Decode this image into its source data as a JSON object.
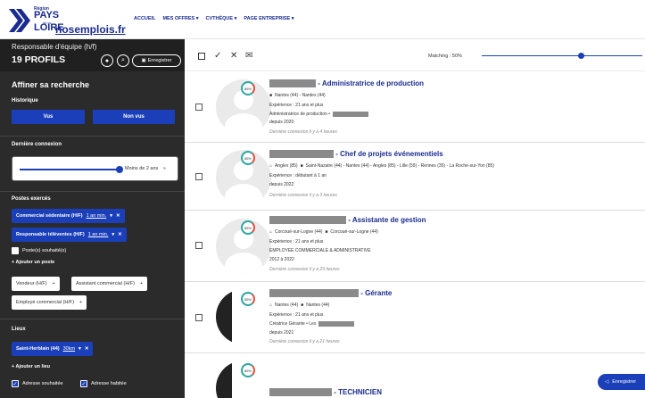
{
  "header": {
    "logo": {
      "region": "Région",
      "pays": "PAYS",
      "dela": "de la",
      "loire": "LOIRE",
      "brand": "nosemplois.fr"
    },
    "nav": [
      "ACCUEIL",
      "MES OFFRES ▾",
      "CVTHÈQUE ▾",
      "PAGE ENTREPRISE ▾"
    ]
  },
  "sidebar": {
    "job_title": "Responsable d'équipe (h/f)",
    "profile_count": "19 PROFILS",
    "save_label": "Enregistrer",
    "refine_title": "Affiner sa recherche",
    "historique": {
      "title": "Historique",
      "seen": "Vus",
      "unseen": "Non vus"
    },
    "last_connection": {
      "title": "Dernière connexion",
      "value": "Moins de 2 ans",
      "arrow": "»"
    },
    "postes": {
      "title": "Postes exercés",
      "selected": [
        {
          "label": "Commercial sédentaire (H/F)",
          "min": "1 an min."
        },
        {
          "label": "Responsable téléventes (H/F)",
          "min": "1 an min."
        }
      ],
      "wished_label": "Poste(s) souhaité(s)",
      "add_label": "+ Ajouter un poste",
      "suggestions": [
        "Vendeur (H/F)",
        "Assistant commercial (H/F)",
        "Employé commercial (H/F)"
      ]
    },
    "lieux": {
      "title": "Lieux",
      "selected": {
        "label": "Saint-Herblain (44)",
        "radius": "30km"
      },
      "add_label": "+ Ajouter un lieu",
      "wished_address": "Adresse souhaitée",
      "lived_address": "Adresse habitée"
    }
  },
  "toolbar": {
    "matching_label": "Matching : 50%",
    "matching_value": 0.5
  },
  "cards": [
    {
      "score": "85%",
      "title": "- Administratrice de production",
      "location": "Nantes (44) - Nantes (44)",
      "experience": "Expérience : 21 ans et plus",
      "role": "Administratrice de production •",
      "since": "depuis 2020",
      "last": "Dernière connexion il y a 4 heures"
    },
    {
      "score": "85%",
      "title": "- Chef de projets événementiels",
      "location_home": "Angles (85)",
      "location": "Saint-Nazaire (44) - Nantes (44) - Angles (85) - Lille (59) - Rennes (35) - La Roche-sur-Yon (85)",
      "experience": "Expérience : débutant à 1 an",
      "since": "depuis 2022",
      "last": "Dernière connexion il y a 3 heures"
    },
    {
      "score": "85%",
      "title": "- Assistante de gestion",
      "location_home": "Corcoué-sur-Logne (44)",
      "location": "Corcoué-sur-Logne (44)",
      "experience": "Expérience : 21 ans et plus",
      "role": "EMPLOYEE COMMERCIALE & ADMINISTRATIVE",
      "since": "2012 à 2022",
      "last": "Dernière connexion il y a 29 heures"
    },
    {
      "score": "85%",
      "title": "- Gérante",
      "location_home": "Nantes (44)",
      "location": "Nantes (44)",
      "experience": "Expérience : 21 ans et plus",
      "role": "Créatrice Gérante • Les",
      "since": "depuis 2021",
      "last": "Dernière connexion il y a 21 heures"
    },
    {
      "score": "85%",
      "title": "- TECHNICIEN"
    }
  ],
  "float_save_label": "Enregistrer",
  "colors": {
    "brand_blue": "#1a3fb8",
    "dark_panel": "#2b2b2b",
    "title_blue": "#1a2b8f"
  }
}
